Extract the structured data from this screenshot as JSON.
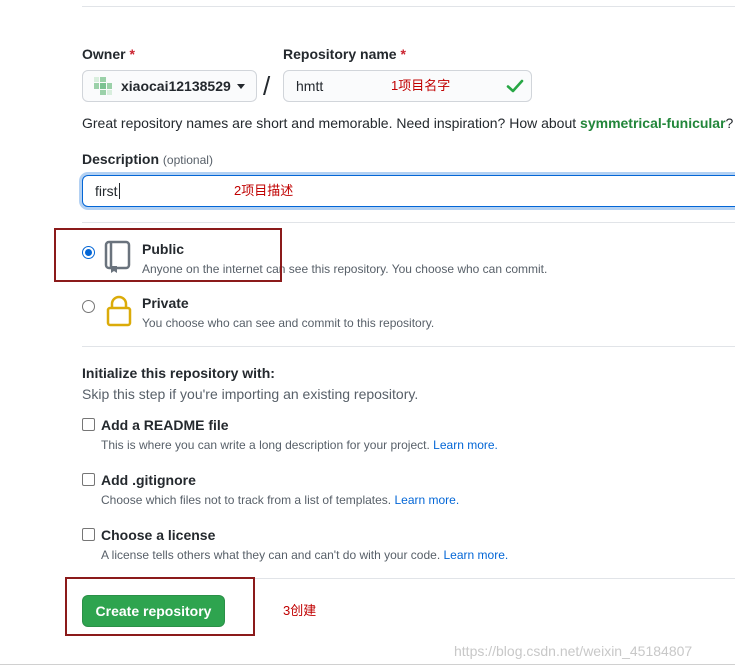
{
  "owner": {
    "label": "Owner",
    "required_mark": "*",
    "value": "xiaocai12138529",
    "separator": "/"
  },
  "repo_name": {
    "label": "Repository name",
    "required_mark": "*",
    "value": "hmtt",
    "annotation": "1项目名字"
  },
  "name_hint": {
    "text": "Great repository names are short and memorable. Need inspiration? How about ",
    "suggestion": "symmetrical-funicular",
    "suffix": "?"
  },
  "description": {
    "label": "Description",
    "optional": "(optional)",
    "value": "first",
    "annotation": "2项目描述"
  },
  "visibility": {
    "public": {
      "title": "Public",
      "desc": "Anyone on the internet can see this repository. You choose who can commit.",
      "selected": true
    },
    "private": {
      "title": "Private",
      "desc": "You choose who can see and commit to this repository.",
      "selected": false
    }
  },
  "init": {
    "heading": "Initialize this repository with:",
    "subheading": "Skip this step if you're importing an existing repository.",
    "options": [
      {
        "title": "Add a README file",
        "desc": "This is where you can write a long description for your project.",
        "link": "Learn more."
      },
      {
        "title": "Add .gitignore",
        "desc": "Choose which files not to track from a list of templates.",
        "link": "Learn more."
      },
      {
        "title": "Choose a license",
        "desc": "A license tells others what they can and can't do with your code.",
        "link": "Learn more."
      }
    ]
  },
  "create_button": {
    "label": "Create repository",
    "annotation": "3创建"
  },
  "watermark": "https://blog.csdn.net/weixin_45184807",
  "colors": {
    "accent_green": "#2ea44f",
    "link_blue": "#0366d6",
    "annotation_red": "#c00000",
    "private_lock": "#dbab09"
  }
}
